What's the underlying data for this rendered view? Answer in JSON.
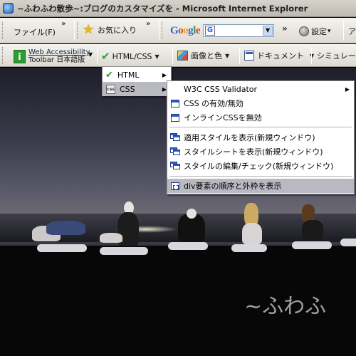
{
  "window": {
    "title": "~ふわふわ散歩~:ブログのカスタマイズを - Microsoft Internet Explorer"
  },
  "toolbar1": {
    "file_menu": "ファイル(F)",
    "overflow": "»",
    "favorites": "お気に入り",
    "google_logo": "Google",
    "google_small": "G",
    "settings": "設定",
    "settings_arrow": "▾",
    "edge_letter": "ア"
  },
  "toolbar2": {
    "wa_line1": "Web Accessibility",
    "wa_line2": "Toolbar  日本語版",
    "html_css": "HTML/CSS",
    "images_colors": "画像と色",
    "documents": "ドキュメント",
    "simulation": "シミュレーシ",
    "dropdown_arrow": "▼"
  },
  "menu_level1": {
    "items": [
      {
        "label": "HTML"
      },
      {
        "label": "CSS",
        "selected": true
      }
    ],
    "arrow": "▶"
  },
  "menu_level2": {
    "items": [
      {
        "label": "W3C CSS Validator",
        "has_submenu": true
      },
      {
        "label": "CSS の有効/無効"
      },
      {
        "label": "インラインCSSを無効"
      },
      {
        "label": "適用スタイルを表示(新規ウィンドウ)"
      },
      {
        "label": "スタイルシートを表示(新規ウィンドウ)"
      },
      {
        "label": "スタイルの編集/チェック(新規ウィンドウ)"
      },
      {
        "label": "div要素の順序と外枠を表示",
        "selected": true
      }
    ],
    "arrow": "▶"
  },
  "scene": {
    "watermark": "~ふわふ"
  }
}
